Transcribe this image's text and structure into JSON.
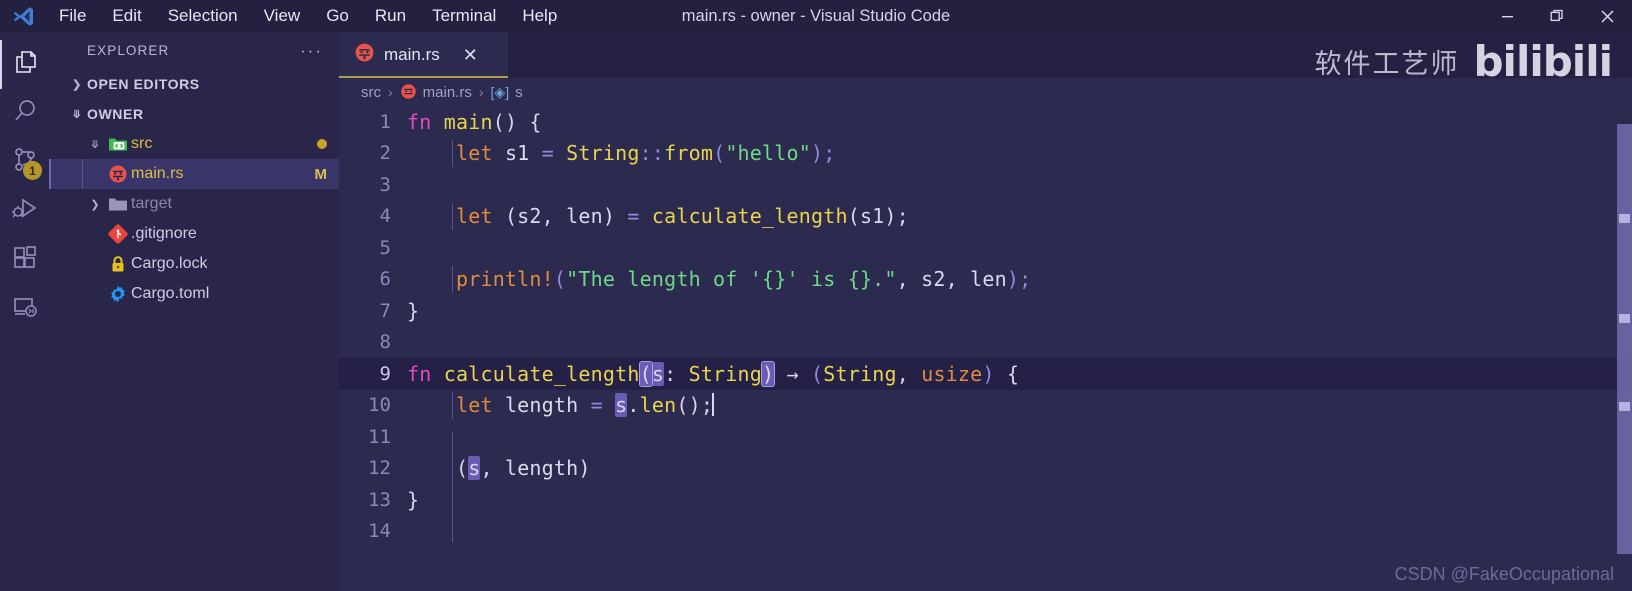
{
  "window": {
    "title": "main.rs - owner - Visual Studio Code",
    "logo_name": "vscode-logo",
    "controls": {
      "minimize": "—",
      "restore": "❐",
      "close": "✕"
    }
  },
  "menubar": {
    "items": [
      "File",
      "Edit",
      "Selection",
      "View",
      "Go",
      "Run",
      "Terminal",
      "Help"
    ]
  },
  "activitybar": {
    "items": [
      {
        "name": "explorer",
        "icon": "files-icon",
        "active": true,
        "badge": ""
      },
      {
        "name": "search",
        "icon": "search-icon",
        "active": false,
        "badge": ""
      },
      {
        "name": "source-control",
        "icon": "source-control-icon",
        "active": false,
        "badge": "1"
      },
      {
        "name": "run-and-debug",
        "icon": "run-debug-icon",
        "active": false,
        "badge": ""
      },
      {
        "name": "extensions",
        "icon": "extensions-icon",
        "active": false,
        "badge": ""
      },
      {
        "name": "remote-explorer",
        "icon": "remote-explorer-icon",
        "active": false,
        "badge": ""
      }
    ]
  },
  "sidebar": {
    "header_title": "EXPLORER",
    "more_actions": "···",
    "sections": [
      {
        "label": "OPEN EDITORS",
        "expanded": false
      },
      {
        "label": "OWNER",
        "expanded": true
      }
    ],
    "tree": [
      {
        "label": "src",
        "icon": "folder-src-icon",
        "indent": 1,
        "expanded": true,
        "badge": "dot",
        "selected": false,
        "dim": false,
        "color": "yellow"
      },
      {
        "label": "main.rs",
        "icon": "rust-file-icon",
        "indent": 2,
        "expanded": null,
        "badge": "M",
        "selected": true,
        "dim": false,
        "color": "yellow"
      },
      {
        "label": "target",
        "icon": "folder-icon",
        "indent": 1,
        "expanded": false,
        "badge": "",
        "selected": false,
        "dim": true,
        "color": "dim"
      },
      {
        "label": ".gitignore",
        "icon": "git-icon",
        "indent": 1,
        "expanded": null,
        "badge": "",
        "selected": false,
        "dim": false,
        "color": "normal"
      },
      {
        "label": "Cargo.lock",
        "icon": "lock-icon",
        "indent": 1,
        "expanded": null,
        "badge": "",
        "selected": false,
        "dim": false,
        "color": "normal"
      },
      {
        "label": "Cargo.toml",
        "icon": "gear-icon",
        "indent": 1,
        "expanded": null,
        "badge": "",
        "selected": false,
        "dim": false,
        "color": "normal"
      }
    ]
  },
  "editor": {
    "tabs": [
      {
        "label": "main.rs",
        "icon": "rust-file-icon",
        "active": true,
        "close": "✕"
      }
    ],
    "breadcrumb": [
      {
        "label": "src",
        "icon": ""
      },
      {
        "label": "main.rs",
        "icon": "rust-file-icon"
      },
      {
        "label": "s",
        "icon": "symbol-variable-icon"
      }
    ],
    "breadcrumb_separator": "›",
    "lines": [
      {
        "n": "1",
        "indent_guide": false
      },
      {
        "n": "2",
        "indent_guide": true
      },
      {
        "n": "3",
        "indent_guide": false
      },
      {
        "n": "4",
        "indent_guide": true
      },
      {
        "n": "5",
        "indent_guide": false
      },
      {
        "n": "6",
        "indent_guide": true
      },
      {
        "n": "7",
        "indent_guide": false
      },
      {
        "n": "8",
        "indent_guide": false
      },
      {
        "n": "9",
        "indent_guide": true
      },
      {
        "n": "10",
        "indent_guide": true
      },
      {
        "n": "11",
        "indent_guide": false
      },
      {
        "n": "12",
        "indent_guide": true
      },
      {
        "n": "13",
        "indent_guide": false
      },
      {
        "n": "14",
        "indent_guide": false
      }
    ],
    "code_text": {
      "l1_fn": "fn",
      "l1_name": "main",
      "l1_rest": "() {",
      "l2_let": "let",
      "l2_var": " s1 ",
      "l2_eq": "= ",
      "l2_type": "String",
      "l2_sep": "::",
      "l2_from": "from",
      "l2_open": "(",
      "l2_str": "\"hello\"",
      "l2_close": ");",
      "l4_let": "let",
      "l4_tuple": " (s2, len) ",
      "l4_eq": "= ",
      "l4_call": "calculate_length",
      "l4_args": "(s1);",
      "l6_macro": "println!",
      "l6_open": "(",
      "l6_str": "\"The length of '{}' is {}.\"",
      "l6_args": ", s2, len",
      "l6_close": ");",
      "l7_brace": "}",
      "l9_fn": "fn",
      "l9_name": " calculate_length",
      "l9_p1": "(",
      "l9_s": "s",
      "l9_colon": ": ",
      "l9_type": "String",
      "l9_p2": ")",
      "l9_arrow": " → ",
      "l9_p3": "(",
      "l9_ret1": "String",
      "l9_comma": ", ",
      "l9_ret2": "usize",
      "l9_p4": ")",
      "l9_brace": " {",
      "l10_let": "let",
      "l10_var": " length ",
      "l10_eq": "= ",
      "l10_s": "s",
      "l10_dot": ".",
      "l10_len": "len",
      "l10_call": "();",
      "l12_open": "(",
      "l12_s": "s",
      "l12_rest": ", length)",
      "l13_brace": "}"
    },
    "scrollbar": {
      "name": "vertical-scrollbar"
    }
  },
  "watermarks": {
    "bilibili_cn": "软件工艺师",
    "bilibili": "bilibili",
    "csdn": "CSDN @FakeOccupational"
  },
  "colors": {
    "titlebar_bg": "#24203f",
    "activitybar_bg": "#2a2649",
    "sidebar_bg": "#2a2649",
    "editor_bg": "#2c2a4e",
    "tab_active_border": "#b39b4e",
    "badge": "#e8c21f",
    "selection": "#6a5cb5",
    "keyword": "#e24bc4",
    "function": "#e8d44d",
    "keyword_let": "#e08c3e",
    "string": "#6fd98a",
    "operator": "#8f8ae0"
  }
}
